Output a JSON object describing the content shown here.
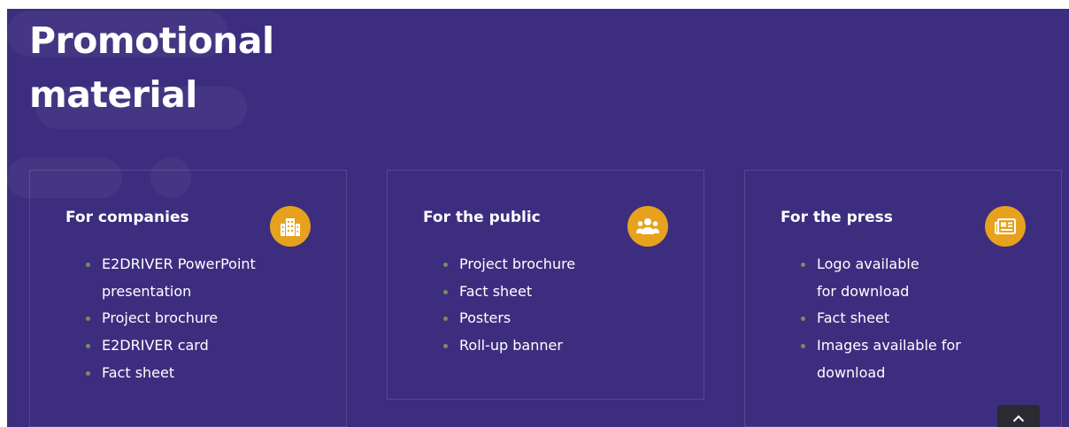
{
  "title_lines": [
    "Promotional",
    "material"
  ],
  "cards": [
    {
      "title": "For companies",
      "icon": "building-icon",
      "items": [
        "E2DRIVER PowerPoint",
        "presentation",
        "Project brochure",
        "E2DRIVER card",
        "Fact sheet"
      ],
      "bullets": [
        true,
        false,
        true,
        true,
        true
      ]
    },
    {
      "title": "For the public",
      "icon": "group-icon",
      "items": [
        "Project brochure",
        "Fact sheet",
        "Posters",
        "Roll-up banner"
      ],
      "bullets": [
        true,
        true,
        true,
        true
      ]
    },
    {
      "title": "For the press",
      "icon": "newspaper-icon",
      "items": [
        "Logo available",
        "for download",
        "Fact sheet",
        "Images available for",
        "download"
      ],
      "bullets": [
        true,
        false,
        true,
        true,
        false
      ]
    }
  ],
  "colors": {
    "background": "#3d2d7f",
    "icon_badge": "#e6a21d",
    "bullet": "#7f8a5e",
    "back_to_top": "#2a2a33"
  }
}
